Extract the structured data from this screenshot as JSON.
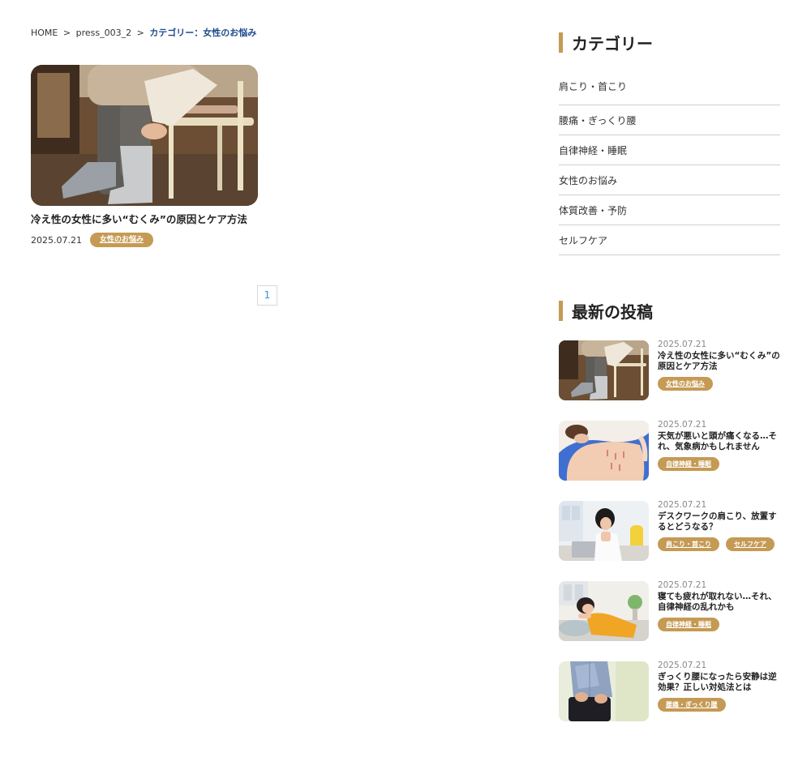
{
  "breadcrumb": {
    "home": "HOME",
    "sep1": ">",
    "press": "press_003_2",
    "sep2": ">",
    "current": "カテゴリー：女性のお悩み"
  },
  "main_post": {
    "title": "冷え性の女性に多い“むくみ”の原因とケア方法",
    "date": "2025.07.21",
    "tag": "女性のお悩み",
    "thumb_icon": "woman-socks-chair-photo"
  },
  "pagination": {
    "current": "1"
  },
  "sidebar": {
    "categories_title": "カテゴリー",
    "categories": [
      "肩こり・首こり",
      "腰痛・ぎっくり腰",
      "自律神経・睡眠",
      "女性のお悩み",
      "体質改善・予防",
      "セルフケア"
    ],
    "latest_title": "最新の投稿",
    "posts": [
      {
        "date": "2025.07.21",
        "title": "冷え性の女性に多い“むくみ”の原因とケア方法",
        "tags": [
          "女性のお悩み"
        ]
      },
      {
        "date": "2025.07.21",
        "title": "天気が悪いと頭が痛くなる…それ、気象病かもしれません",
        "tags": [
          "自律神経・睡眠"
        ]
      },
      {
        "date": "2025.07.21",
        "title": "デスクワークの肩こり、放置するとどうなる？",
        "tags": [
          "肩こり・首こり",
          "セルフケア"
        ]
      },
      {
        "date": "2025.07.21",
        "title": "寝ても疲れが取れない…それ、自律神経の乱れかも",
        "tags": [
          "自律神経・睡眠"
        ]
      },
      {
        "date": "2025.07.21",
        "title": "ぎっくり腰になったら安静は逆効果？正しい対処法とは",
        "tags": [
          "腰痛・ぎっくり腰"
        ]
      }
    ]
  },
  "colors": {
    "accent": "#c59a54",
    "breadcrumb_current": "#1f4a8c",
    "pagination": "#3a8fd6"
  }
}
